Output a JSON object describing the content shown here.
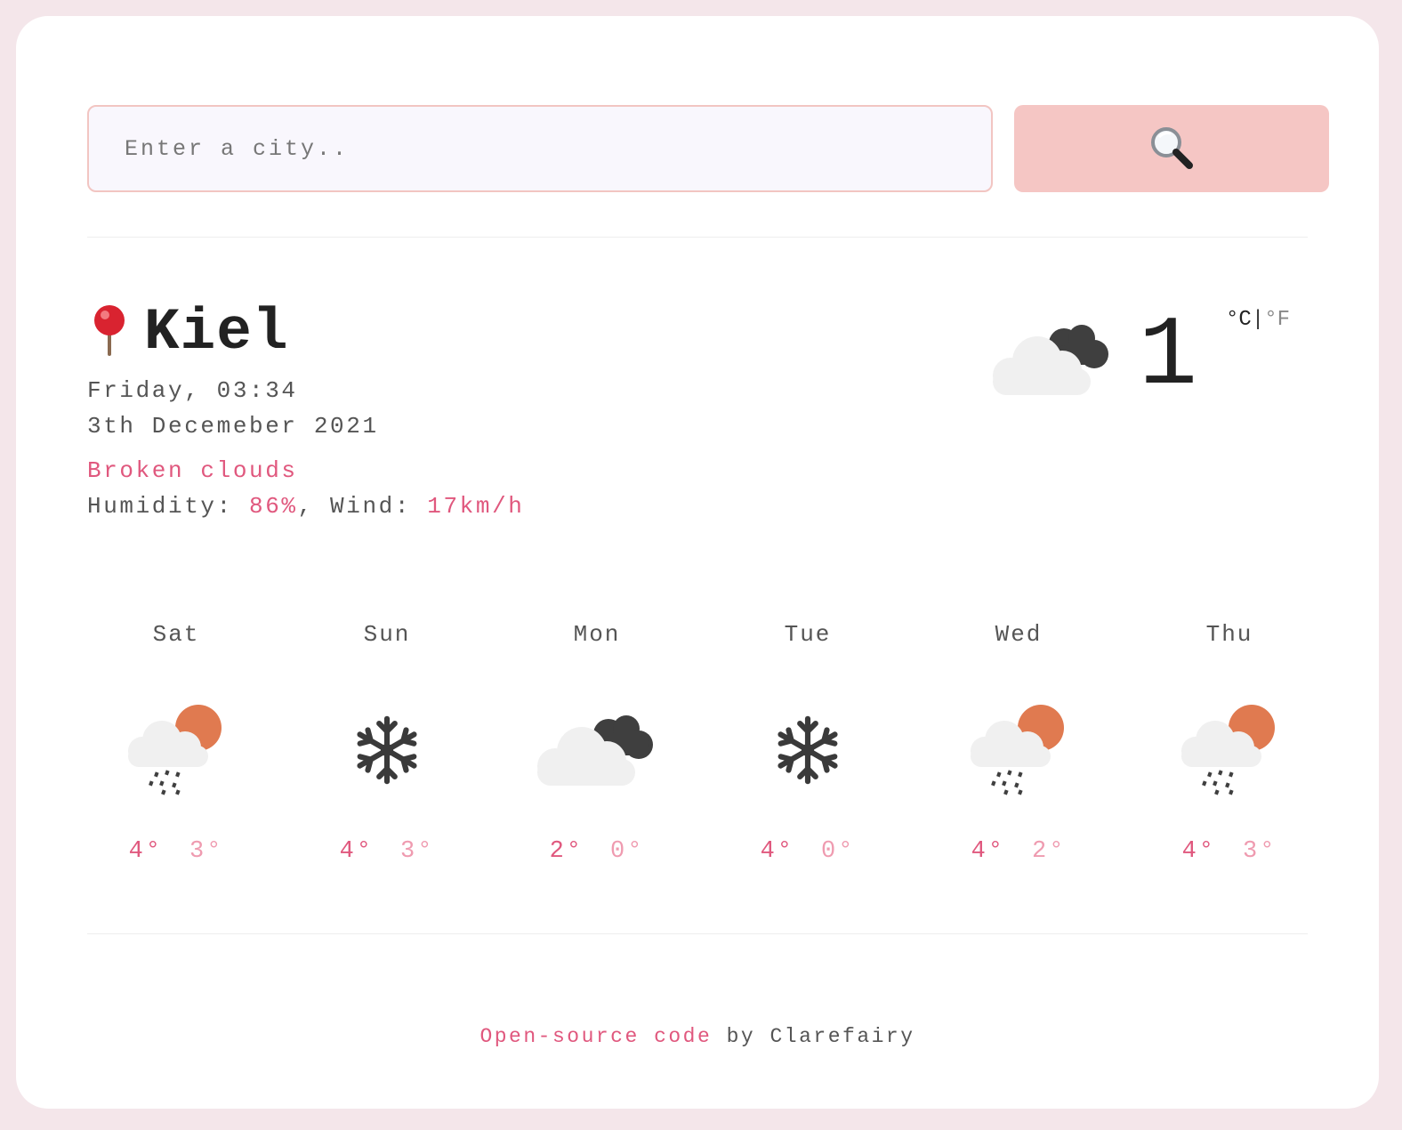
{
  "search": {
    "placeholder": "Enter a city..",
    "button_icon": "magnifying-glass-icon"
  },
  "current": {
    "pin_icon": "pushpin-icon",
    "city": "Kiel",
    "day_time": "Friday, 03:34",
    "date": "3th Decemeber 2021",
    "description": "Broken clouds",
    "humidity_label": "Humidity: ",
    "humidity_value": "86%",
    "wind_label": ", Wind: ",
    "wind_value": "17km/h",
    "icon": "broken-clouds-icon",
    "temperature": "1",
    "unit_celsius": "°C",
    "unit_separator": "|",
    "unit_fahrenheit": "°F"
  },
  "forecast": [
    {
      "day": "Sat",
      "icon": "rain-sun-icon",
      "max": "4°",
      "min": "3°"
    },
    {
      "day": "Sun",
      "icon": "snowflake-icon",
      "max": "4°",
      "min": "3°"
    },
    {
      "day": "Mon",
      "icon": "broken-clouds-icon",
      "max": "2°",
      "min": "0°"
    },
    {
      "day": "Tue",
      "icon": "snowflake-icon",
      "max": "4°",
      "min": "0°"
    },
    {
      "day": "Wed",
      "icon": "rain-sun-icon",
      "max": "4°",
      "min": "2°"
    },
    {
      "day": "Thu",
      "icon": "rain-sun-icon",
      "max": "4°",
      "min": "3°"
    }
  ],
  "footer": {
    "link_text": "Open-source code",
    "suffix": " by Clarefairy"
  },
  "colors": {
    "accent": "#e0587e",
    "accent_light": "#ef9bb0",
    "button_bg": "#f5c6c4",
    "page_bg": "#f4e6ea"
  }
}
